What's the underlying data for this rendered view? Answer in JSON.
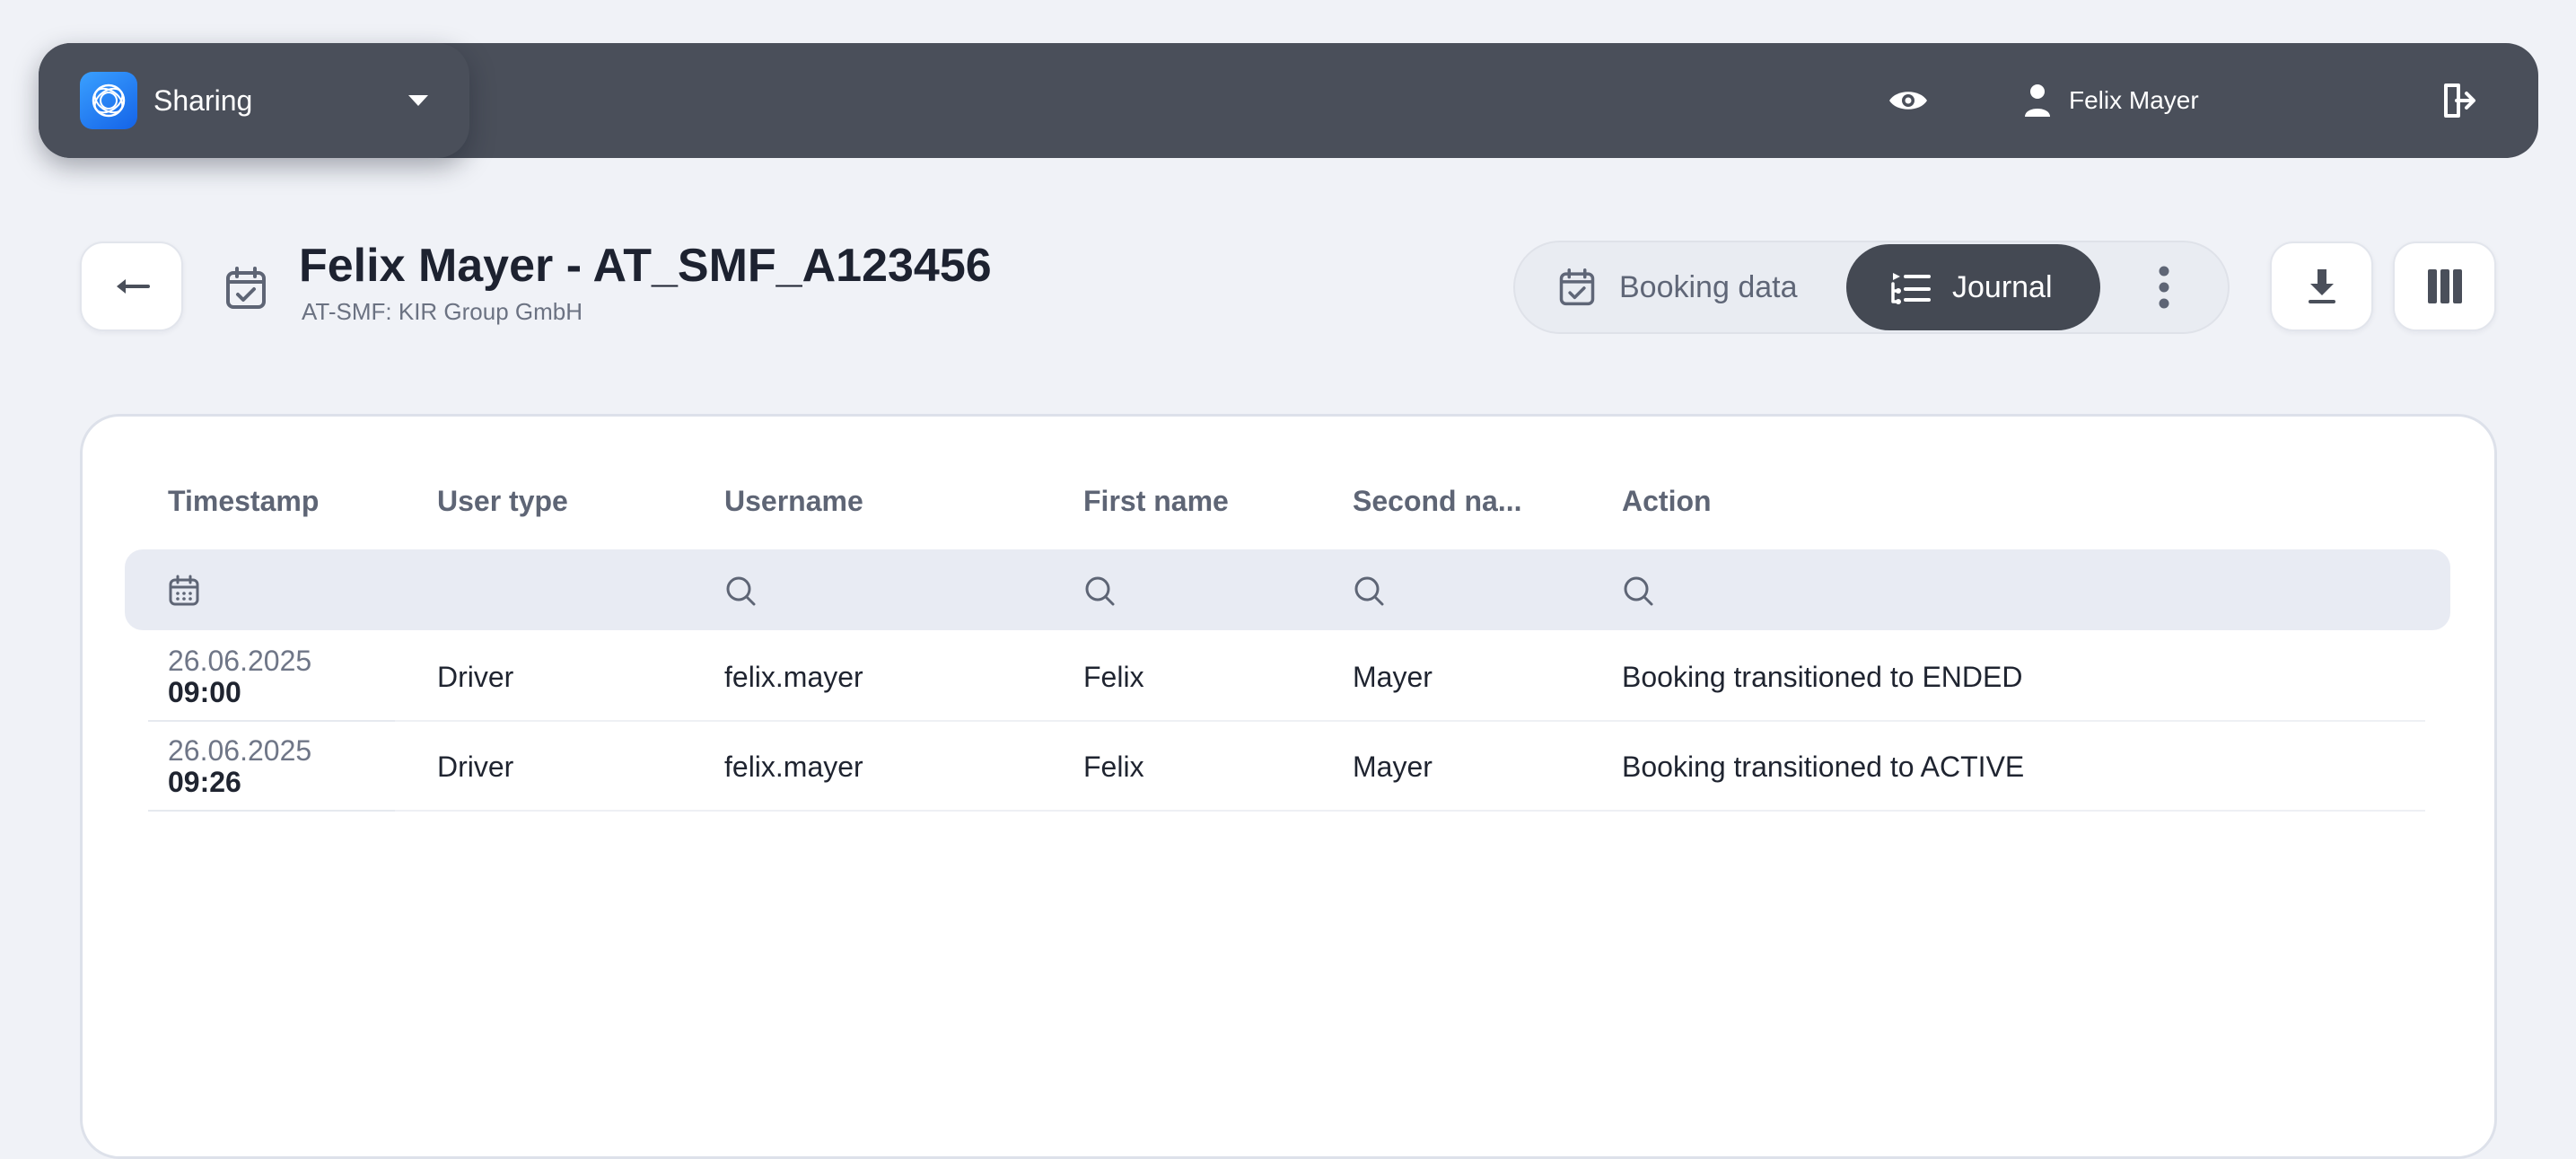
{
  "app": {
    "name": "Sharing"
  },
  "topbar": {
    "user_name": "Felix Mayer"
  },
  "header": {
    "title": "Felix Mayer - AT_SMF_A123456",
    "subtitle": "AT-SMF: KIR Group GmbH"
  },
  "tabs": {
    "booking_data": "Booking data",
    "journal": "Journal",
    "active": "Journal"
  },
  "table": {
    "columns": [
      "Timestamp",
      "User type",
      "Username",
      "First name",
      "Second na...",
      "Action"
    ],
    "rows": [
      {
        "date": "26.06.2025",
        "time": "09:00",
        "user_type": "Driver",
        "username": "felix.mayer",
        "first_name": "Felix",
        "second_name": "Mayer",
        "action": "Booking transitioned to ENDED"
      },
      {
        "date": "26.06.2025",
        "time": "09:26",
        "user_type": "Driver",
        "username": "felix.mayer",
        "first_name": "Felix",
        "second_name": "Mayer",
        "action": "Booking transitioned to ACTIVE"
      }
    ]
  },
  "icons": {
    "app_logo": "sharing-logo-icon",
    "app_switch": "chevron-down-icon",
    "view": "eye-icon",
    "user": "user-icon",
    "logout": "logout-icon",
    "back": "arrow-left-icon",
    "title": "calendar-check-icon",
    "booking_tab": "calendar-check-icon",
    "journal_tab": "list-icon",
    "more": "more-vertical-icon",
    "download": "download-icon",
    "columns": "columns-icon",
    "date_filter": "calendar-icon",
    "text_filter": "search-icon"
  },
  "colors": {
    "topbar": "#4a4f5a",
    "active_tab": "#444953",
    "page_background": "#f0f2f7",
    "logo_gradient_start": "#3aa0ff",
    "logo_gradient_end": "#1463e8"
  }
}
